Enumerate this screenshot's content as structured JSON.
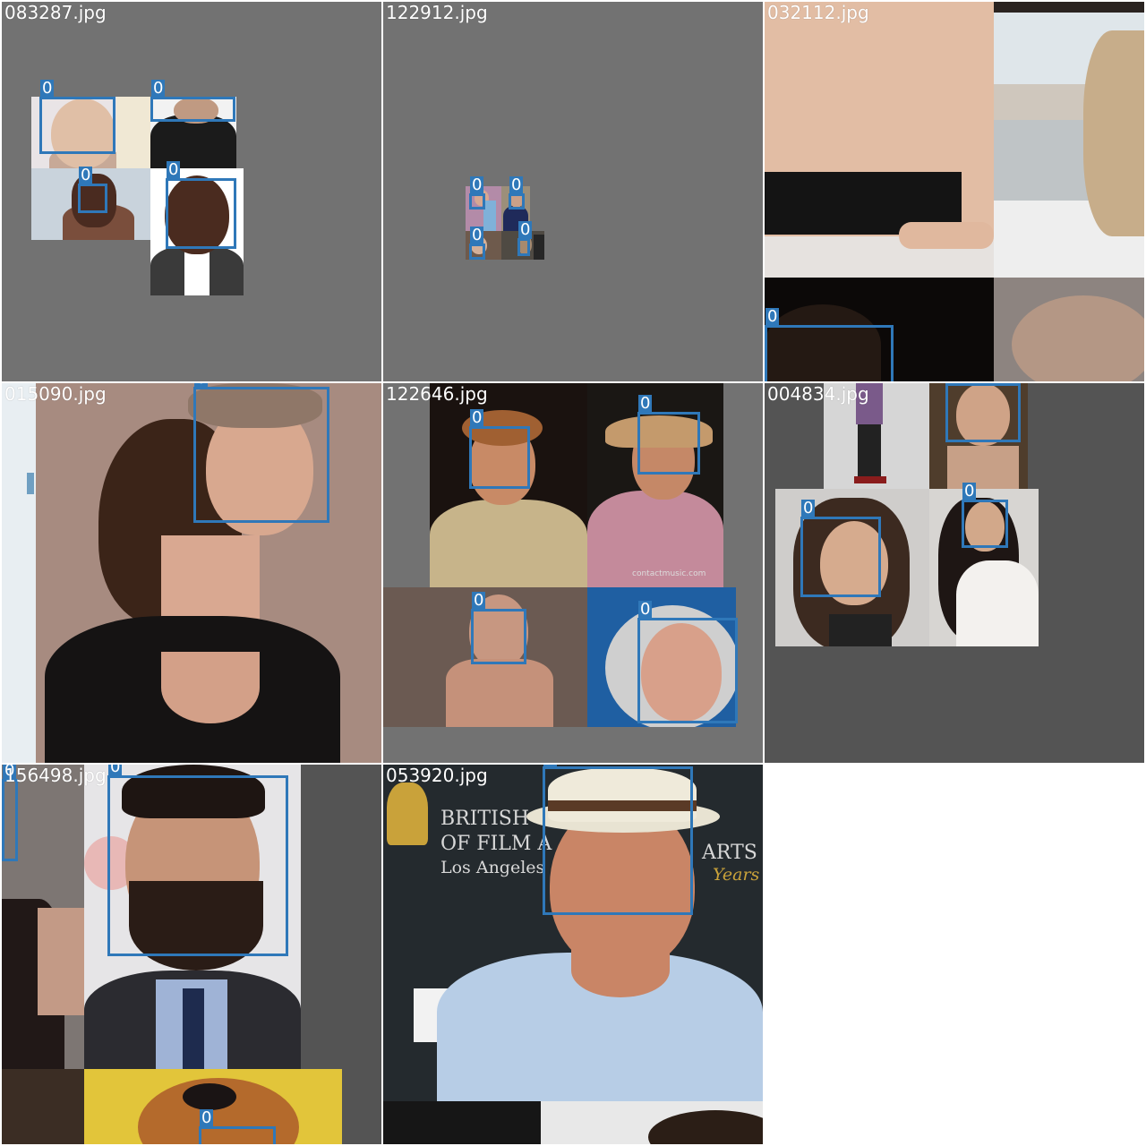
{
  "tiles": [
    {
      "title": "083287.jpg",
      "class_label": "0"
    },
    {
      "title": "122912.jpg",
      "class_label": "0"
    },
    {
      "title": "032112.jpg",
      "class_label": "0"
    },
    {
      "title": "015090.jpg",
      "class_label": "0"
    },
    {
      "title": "122646.jpg",
      "class_label": "0"
    },
    {
      "title": "004834.jpg",
      "class_label": "0"
    },
    {
      "title": "156498.jpg",
      "class_label": "0"
    },
    {
      "title": "053920.jpg",
      "class_label": "0"
    }
  ],
  "overlay_texts": {
    "bafta_line1": "BRITISH",
    "bafta_line2": "OF FILM A",
    "bafta_line3": "Los Angeles",
    "bafta_right1": "ARTS",
    "bafta_right2": "Years",
    "watermark": "contactmusic.com"
  },
  "colors": {
    "box": "#2f78b9",
    "canvas_gray": "#727272",
    "dark_gray": "#545454"
  }
}
